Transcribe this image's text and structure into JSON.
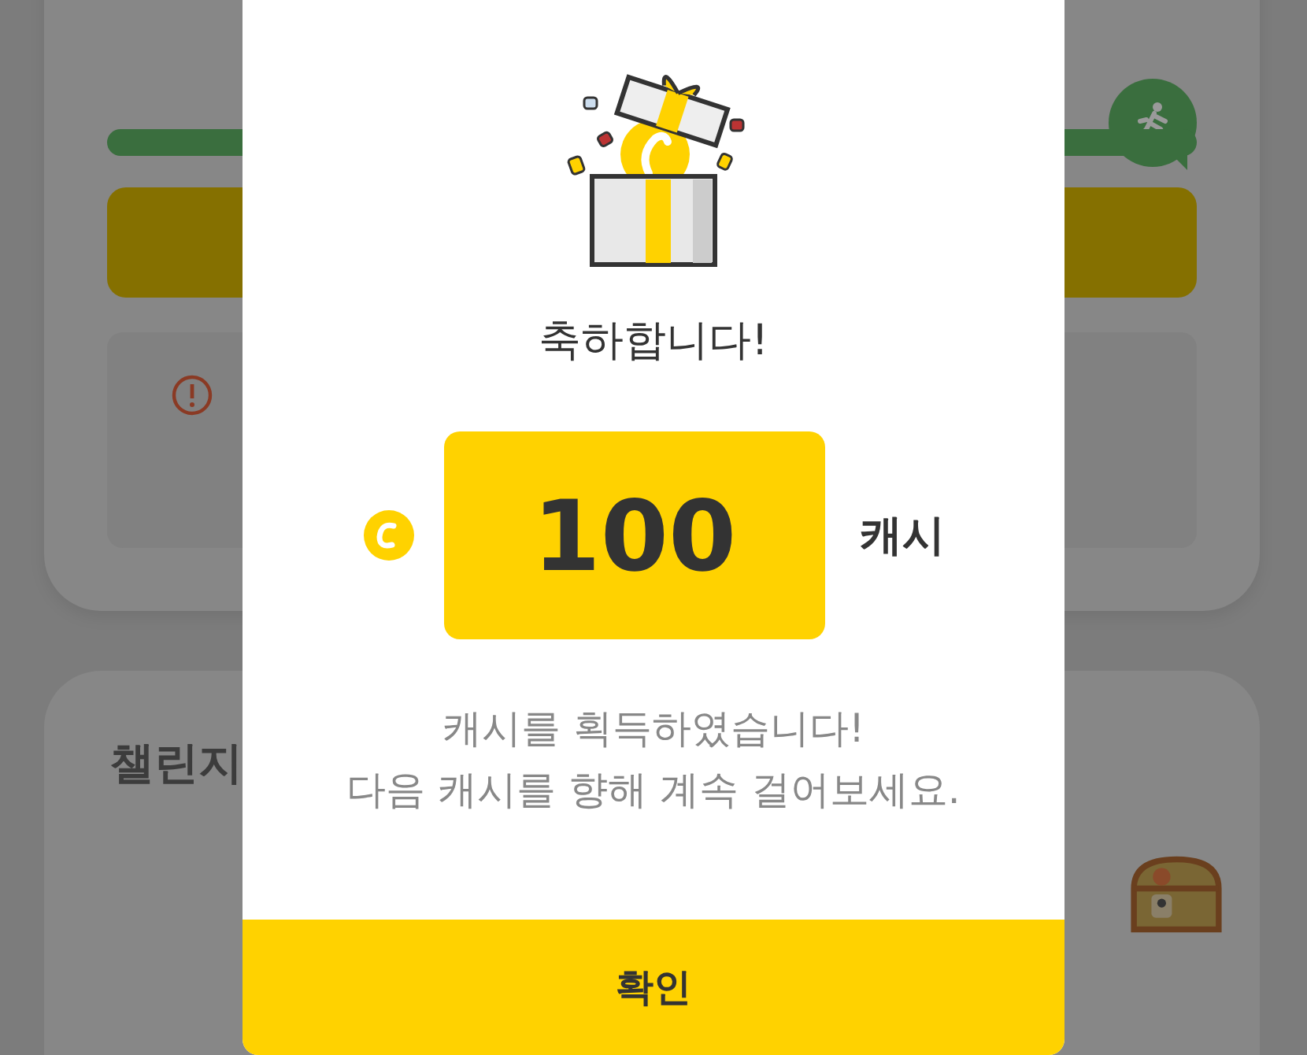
{
  "background": {
    "section_title": "챌린지"
  },
  "dialog": {
    "title": "축하합니다!",
    "amount": "100",
    "unit": "캐시",
    "message_lines": [
      "캐시를 획득하였습니다!",
      "다음 캐시를 향해 계속 걸어보세요."
    ],
    "confirm_button": "확인"
  }
}
